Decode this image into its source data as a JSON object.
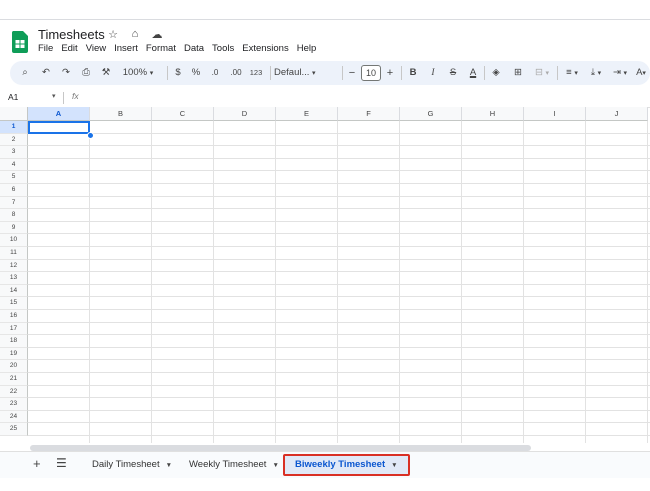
{
  "app": {
    "title": "Timesheets"
  },
  "menu": [
    "File",
    "Edit",
    "View",
    "Insert",
    "Format",
    "Data",
    "Tools",
    "Extensions",
    "Help"
  ],
  "toolbar": {
    "zoom": "100%",
    "currency": "$",
    "percent": "%",
    "decrease_decimal": ".0",
    "increase_decimal": ".00",
    "number_format": "123",
    "font": "Defaul...",
    "font_size": "10"
  },
  "formula_bar": {
    "cell_ref": "A1",
    "fx": "fx"
  },
  "columns": [
    "A",
    "B",
    "C",
    "D",
    "E",
    "F",
    "G",
    "H",
    "I",
    "J"
  ],
  "rows": [
    "1",
    "2",
    "3",
    "4",
    "5",
    "6",
    "7",
    "8",
    "9",
    "10",
    "11",
    "12",
    "13",
    "14",
    "15",
    "16",
    "17",
    "18",
    "19",
    "20",
    "21",
    "22",
    "23",
    "24",
    "25"
  ],
  "selected_cell": "A1",
  "sheets": [
    {
      "label": "Daily Timesheet",
      "active": false
    },
    {
      "label": "Weekly Timesheet",
      "active": false
    },
    {
      "label": "Biweekly Timesheet",
      "active": true
    }
  ],
  "colors": {
    "accent": "#1a73e8",
    "sheets_green": "#0f9d58",
    "highlight_border": "#d93025"
  }
}
